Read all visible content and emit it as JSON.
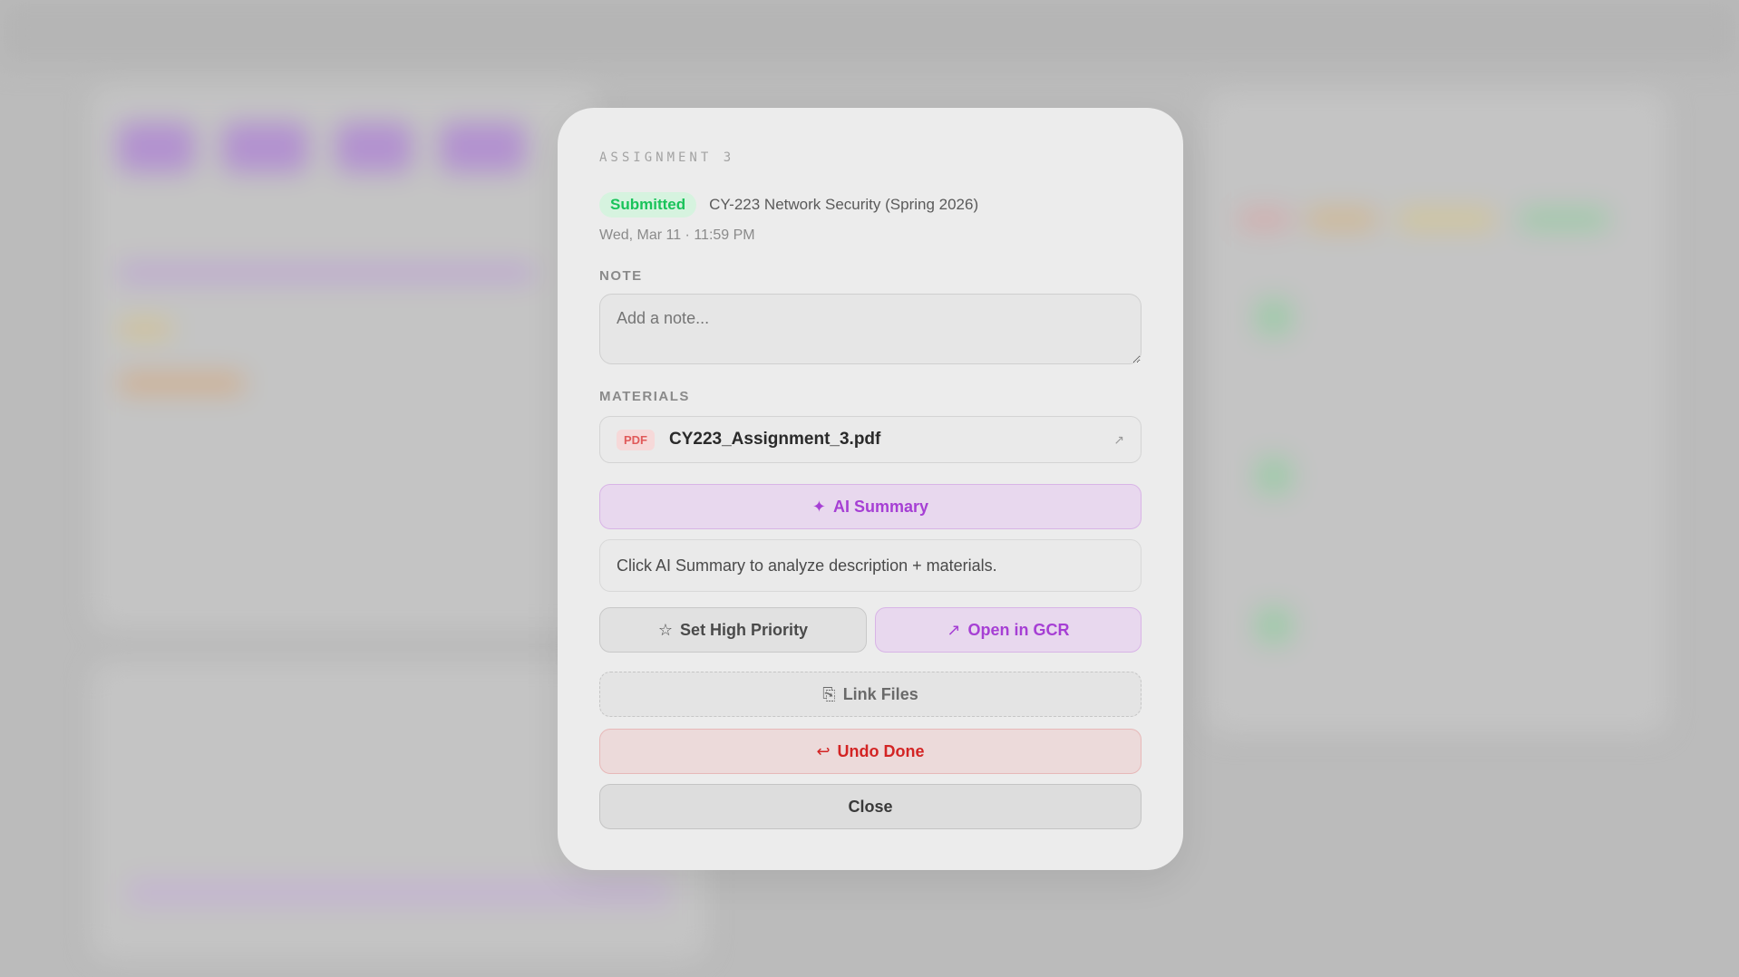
{
  "modal": {
    "eyebrow": "ASSIGNMENT 3",
    "status": "Submitted",
    "course": "CY-223 Network Security (Spring 2026)",
    "due": "Wed, Mar 11 · 11:59 PM",
    "note_label": "NOTE",
    "note_placeholder": "Add a note...",
    "materials_label": "MATERIALS",
    "materials": [
      {
        "type": "PDF",
        "name": "CY223_Assignment_3.pdf",
        "icon": "external-link-icon"
      }
    ],
    "ai_summary_label": "AI Summary",
    "ai_summary_icon": "sparkle-icon",
    "summary_text": "Click AI Summary to analyze description + materials.",
    "priority_label": "Set High Priority",
    "priority_icon": "star-icon",
    "open_gcr_label": "Open in GCR",
    "open_gcr_icon": "arrow-up-right-icon",
    "link_files_label": "Link Files",
    "link_files_icon": "paperclip-icon",
    "undo_label": "Undo Done",
    "undo_icon": "undo-arrow-icon",
    "close_label": "Close"
  },
  "colors": {
    "success": "#19c35a",
    "accent": "#a63fd4",
    "danger": "#d32424"
  }
}
